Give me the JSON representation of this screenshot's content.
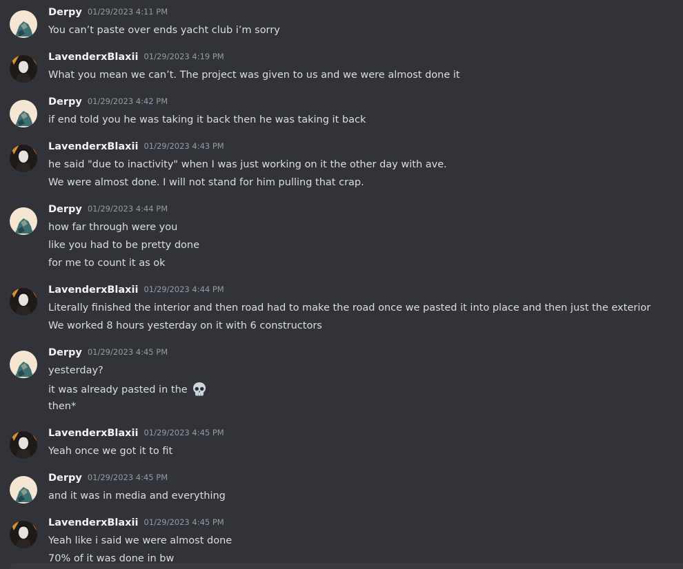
{
  "messages": [
    {
      "author": "Derpy",
      "timestamp": "01/29/2023 4:11 PM",
      "lines": [
        "You can’t paste over ends yacht club i’m sorry"
      ]
    },
    {
      "author": "LavenderxBlaxii",
      "timestamp": "01/29/2023 4:19 PM",
      "lines": [
        "What you mean we can’t. The project was given to us and we were almost done it"
      ]
    },
    {
      "author": "Derpy",
      "timestamp": "01/29/2023 4:42 PM",
      "lines": [
        "if end told you he was taking it back then he was taking it back"
      ]
    },
    {
      "author": "LavenderxBlaxii",
      "timestamp": "01/29/2023 4:43 PM",
      "lines": [
        "he said \"due to inactivity\" when I was just working on it the other day with ave.",
        "We were almost done. I will not stand for him pulling that crap."
      ]
    },
    {
      "author": "Derpy",
      "timestamp": "01/29/2023 4:44 PM",
      "lines": [
        "how far through were you",
        "like you had to be pretty done",
        "for me to count it as ok"
      ]
    },
    {
      "author": "LavenderxBlaxii",
      "timestamp": "01/29/2023 4:44 PM",
      "lines": [
        "Literally finished the interior and then road had to make the road once we pasted it into place and then just the exterior",
        "We worked 8 hours yesterday on it with 6 constructors"
      ]
    },
    {
      "author": "Derpy",
      "timestamp": "01/29/2023 4:45 PM",
      "lines": [
        "yesterday?",
        "it was already pasted in the",
        "then*"
      ]
    },
    {
      "author": "LavenderxBlaxii",
      "timestamp": "01/29/2023 4:45 PM",
      "lines": [
        "Yeah once we got it to fit"
      ]
    },
    {
      "author": "Derpy",
      "timestamp": "01/29/2023 4:45 PM",
      "lines": [
        "and it was in media and everything"
      ]
    },
    {
      "author": "LavenderxBlaxii",
      "timestamp": "01/29/2023 4:45 PM",
      "lines": [
        "Yeah like i said we were almost done",
        "70% of it was done in bw"
      ]
    }
  ],
  "icons": {
    "derpy_avatar": "derpy-avatar",
    "lavender_avatar": "lavender-avatar",
    "skull_emoji": "skull-emoji-icon"
  },
  "colors": {
    "background": "#313338",
    "author": "#f2f3f5",
    "timestamp": "#949ba4",
    "text": "#dbdee1"
  }
}
